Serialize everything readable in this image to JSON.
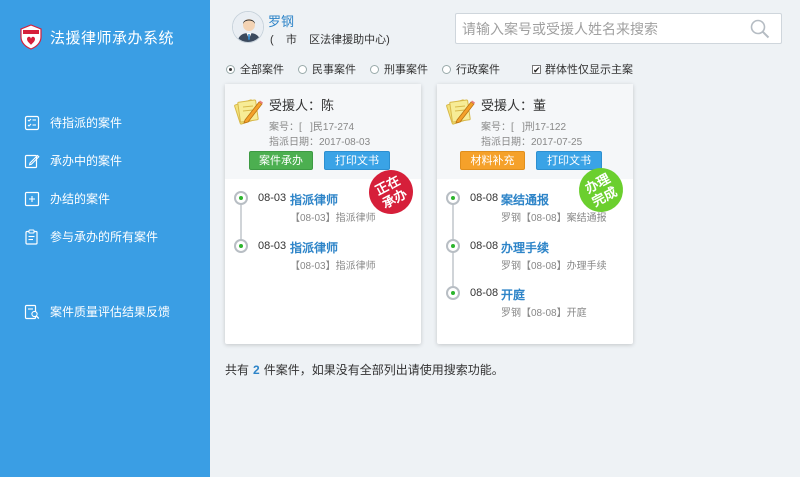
{
  "sidebar": {
    "title": "法援律师承办系统",
    "logo_text": "法律援助",
    "items": [
      {
        "label": "待指派的案件",
        "icon": "list-check-icon"
      },
      {
        "label": "承办中的案件",
        "icon": "edit-doc-icon"
      },
      {
        "label": "办结的案件",
        "icon": "done-doc-icon"
      },
      {
        "label": "参与承办的所有案件",
        "icon": "clipboard-icon"
      },
      {
        "label": "案件质量评估结果反馈",
        "icon": "doc-search-icon"
      }
    ]
  },
  "header": {
    "user_name": "罗钢",
    "user_org": "(    市    区法律援助中心)",
    "search_placeholder": "请输入案号或受援人姓名来搜索"
  },
  "filters": {
    "options": [
      "全部案件",
      "民事案件",
      "刑事案件",
      "行政案件"
    ],
    "selected": "全部案件",
    "checkbox_label": "群体性仅显示主案",
    "checkbox_checked": true
  },
  "cards": [
    {
      "client": "受援人：陈",
      "case_no": "案号：[   ]民17-274",
      "assign_date": "指派日期：2017-08-03",
      "buttons": [
        "案件承办",
        "打印文书"
      ],
      "stamp": "正在\n承办",
      "stamp_color": "#d61f3a",
      "timeline": [
        {
          "date": "08-03",
          "title": "指派律师",
          "sub": "【08-03】指派律师"
        },
        {
          "date": "08-03",
          "title": "指派律师",
          "sub": "【08-03】指派律师"
        }
      ]
    },
    {
      "client": "受援人：董",
      "case_no": "案号：[   ]刑17-122",
      "assign_date": "指派日期：2017-07-25",
      "buttons": [
        "材料补充",
        "打印文书"
      ],
      "stamp": "办理\n完成",
      "stamp_color": "#6bcf2e",
      "timeline": [
        {
          "date": "08-08",
          "title": "案结通报",
          "sub": "罗钢【08-08】案结通报"
        },
        {
          "date": "08-08",
          "title": "办理手续",
          "sub": "罗钢【08-08】办理手续"
        },
        {
          "date": "08-08",
          "title": "开庭",
          "sub": "罗钢【08-08】开庭"
        }
      ]
    }
  ],
  "footer": {
    "prefix": "共有",
    "count": "2",
    "suffix": "件案件，如果没有全部列出请使用搜索功能。"
  },
  "colors": {
    "sidebar_bg": "#3a9ee4",
    "accent": "#2d84c8",
    "green_button": "#4caf50",
    "blue_button": "#3aa3e6",
    "orange_button": "#f5a12a",
    "stamp_red": "#d61f3a",
    "stamp_green": "#6bcf2e"
  }
}
